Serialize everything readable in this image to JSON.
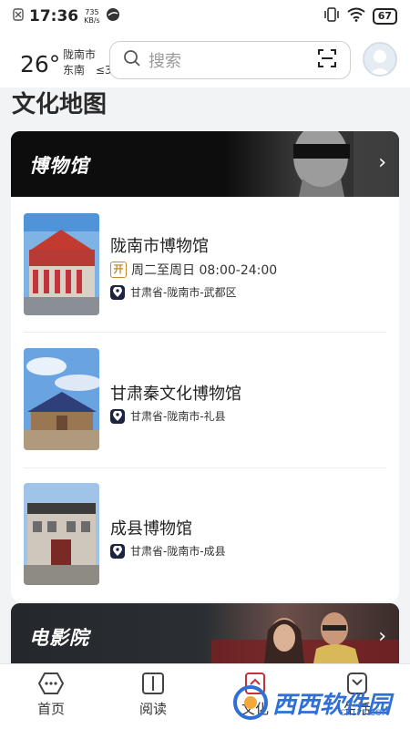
{
  "status_bar": {
    "time": "17:36",
    "net_speed_value": "735",
    "net_speed_unit": "KB/s",
    "battery": "67"
  },
  "header": {
    "temperature": "26°",
    "city": "陇南市",
    "wind_dir": "东南",
    "wind_level": "≤3"
  },
  "search": {
    "placeholder": "搜索"
  },
  "page": {
    "section_title": "文化地图"
  },
  "museum_section": {
    "title": "博物馆",
    "items": [
      {
        "name": "陇南市博物馆",
        "hours": "周二至周日 08:00-24:00",
        "open_badge": "开",
        "address": "甘肃省-陇南市-武都区"
      },
      {
        "name": "甘肃秦文化博物馆",
        "address": "甘肃省-陇南市-礼县"
      },
      {
        "name": "成县博物馆",
        "address": "甘肃省-陇南市-成县"
      }
    ]
  },
  "cinema_section": {
    "title": "电影院"
  },
  "bottom_nav": {
    "tabs": [
      "首页",
      "阅读",
      "文化",
      "生活"
    ]
  },
  "watermark": {
    "text": "西西软件园",
    "sub": "CR173.COM"
  },
  "colors": {
    "accent_orange": "#c98a2d",
    "pin_navy": "#1c2340",
    "banner_bg": "#0d0d0d"
  }
}
